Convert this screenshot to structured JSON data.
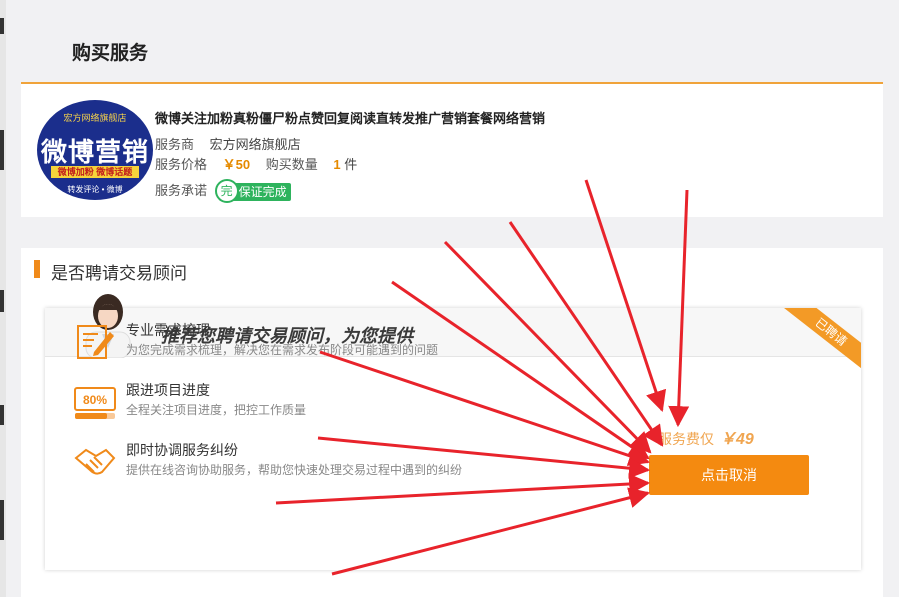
{
  "page": {
    "title": "购买服务"
  },
  "product": {
    "logo": {
      "tag": "宏方网络旗舰店",
      "main": "微博营销",
      "sub": "微博加粉  微博话题",
      "foot": "转发评论 • 微博"
    },
    "name": "微博关注加粉真粉僵尸粉点赞回复阅读直转发推广营销套餐网络营销",
    "provider_label": "服务商",
    "provider": "宏方网络旗舰店",
    "price_label": "服务价格",
    "price": "￥50",
    "qty_label": "购买数量",
    "qty": "1",
    "qty_unit": "件",
    "promise_label": "服务承诺",
    "promise_seal": "完",
    "promise_badge": "保证完成"
  },
  "advisor": {
    "section_title": "是否聘请交易顾问",
    "recommend": "推荐您聘请交易顾问，为您提供",
    "ribbon": "已聘请",
    "features": [
      {
        "title": "专业需求梳理",
        "desc": "为您完成需求梳理，解决您在需求发布阶段可能遇到的问题",
        "icon": "document-pen-icon"
      },
      {
        "title": "跟进项目进度",
        "desc": "全程关注项目进度，把控工作质量",
        "icon": "progress-icon",
        "icon_text": "80%"
      },
      {
        "title": "即时协调服务纠纷",
        "desc": "提供在线咨询协助服务，帮助您快速处理交易过程中遇到的纠纷",
        "icon": "handshake-icon"
      }
    ],
    "fee_label": "服务费仅",
    "fee_price": "￥49",
    "cancel_button": "点击取消"
  },
  "colors": {
    "accent": "#f48a10",
    "badge": "#2eb35d",
    "arrow": "#e8232b"
  }
}
